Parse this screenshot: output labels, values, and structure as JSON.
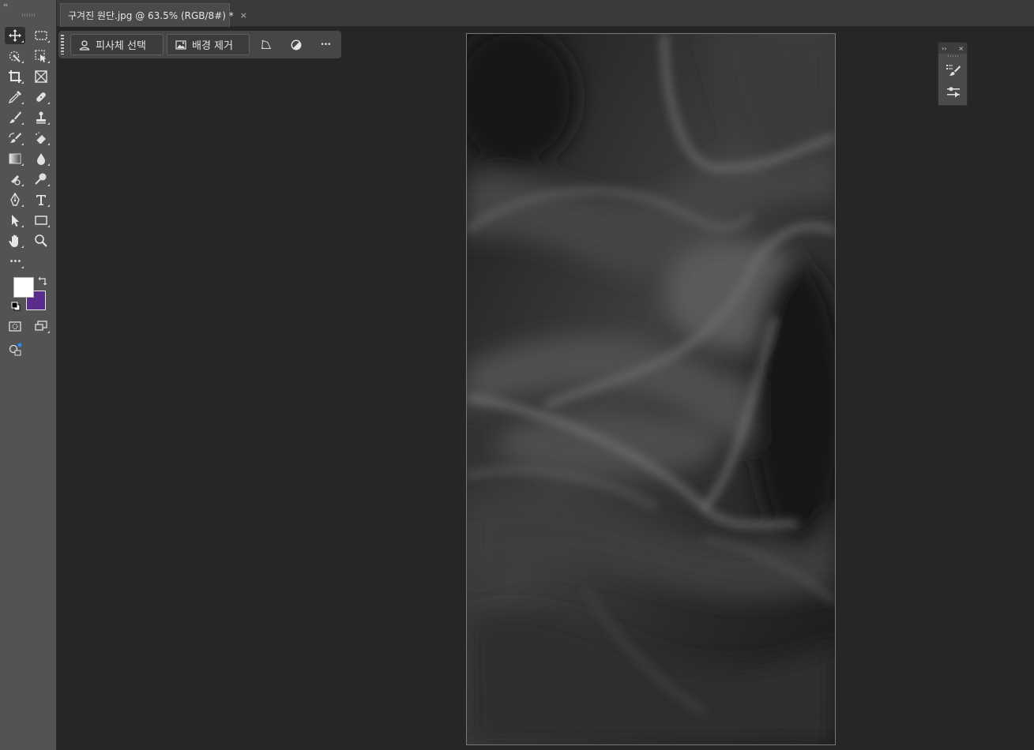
{
  "document": {
    "tab_title": "구겨진 원단.jpg @ 63.5% (RGB/8#) *",
    "close_glyph": "×"
  },
  "toolbar": {
    "collapse_glyph": "‹‹",
    "more_glyph": "•••",
    "tools": [
      {
        "icon": "move-tool-icon",
        "active": true
      },
      {
        "icon": "rectangular-marquee-icon"
      },
      {
        "icon": "quick-selection-icon"
      },
      {
        "icon": "object-selection-icon"
      },
      {
        "icon": "crop-icon"
      },
      {
        "icon": "frame-icon"
      },
      {
        "icon": "eyedropper-icon"
      },
      {
        "icon": "spot-healing-icon"
      },
      {
        "icon": "brush-icon"
      },
      {
        "icon": "clone-stamp-icon"
      },
      {
        "icon": "history-brush-icon"
      },
      {
        "icon": "eraser-icon"
      },
      {
        "icon": "gradient-icon"
      },
      {
        "icon": "blur-icon"
      },
      {
        "icon": "dodge-burn-icon"
      },
      {
        "icon": "smudge-icon"
      },
      {
        "icon": "pen-icon"
      },
      {
        "icon": "type-icon"
      },
      {
        "icon": "path-selection-icon"
      },
      {
        "icon": "rectangle-shape-icon"
      },
      {
        "icon": "hand-icon"
      },
      {
        "icon": "zoom-icon"
      }
    ],
    "colors": {
      "foreground": "#ffffff",
      "background": "#5a2d8c"
    }
  },
  "taskbar": {
    "select_subject_label": "피사체 선택",
    "remove_background_label": "배경 제거",
    "more_glyph": "•••"
  },
  "floating_panel": {
    "expand_glyph": "››",
    "close_glyph": "×"
  },
  "colors": {
    "workspace": "#262626",
    "toolbar": "#535353",
    "accent": "#2d8ceb"
  }
}
